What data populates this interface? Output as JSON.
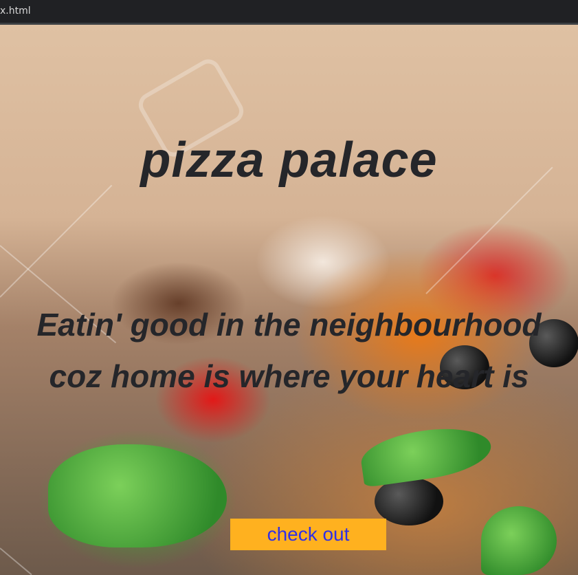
{
  "browser": {
    "tab_title": "x.html"
  },
  "hero": {
    "title": "pizza palace",
    "tagline_line1": "Eatin' good in the neighbourhood",
    "tagline_line2": "coz home is where your heart is",
    "checkout_label": "check out"
  },
  "colors": {
    "heading_text": "#25262a",
    "button_bg": "#ffb11f",
    "button_text": "#3030e6"
  }
}
